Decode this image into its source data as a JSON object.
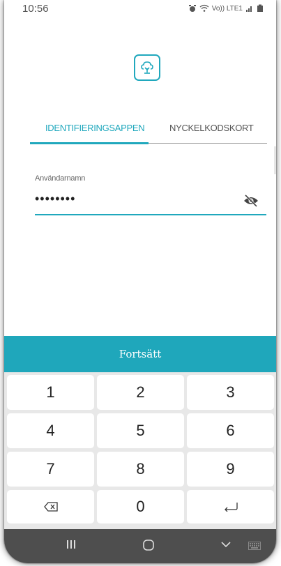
{
  "status": {
    "time": "10:56",
    "network": "Vo)) LTE1"
  },
  "tabs": [
    {
      "label": "IDENTIFIERINGSAPPEN",
      "active": true
    },
    {
      "label": "NYCKELKODSKORT",
      "active": false
    }
  ],
  "form": {
    "username_label": "Användarnamn",
    "username_value": "••••••••"
  },
  "continue_label": "Fortsätt",
  "keypad": {
    "keys": [
      "1",
      "2",
      "3",
      "4",
      "5",
      "6",
      "7",
      "8",
      "9",
      "⌫",
      "0",
      "↵"
    ]
  },
  "colors": {
    "accent": "#1fa7bb",
    "keypad_bg": "#e8e8e8",
    "navbar": "#4e4e4e"
  },
  "icons": {
    "logo": "tree-icon",
    "eye": "eye-off-icon",
    "backspace": "backspace-icon",
    "enter": "enter-icon"
  }
}
